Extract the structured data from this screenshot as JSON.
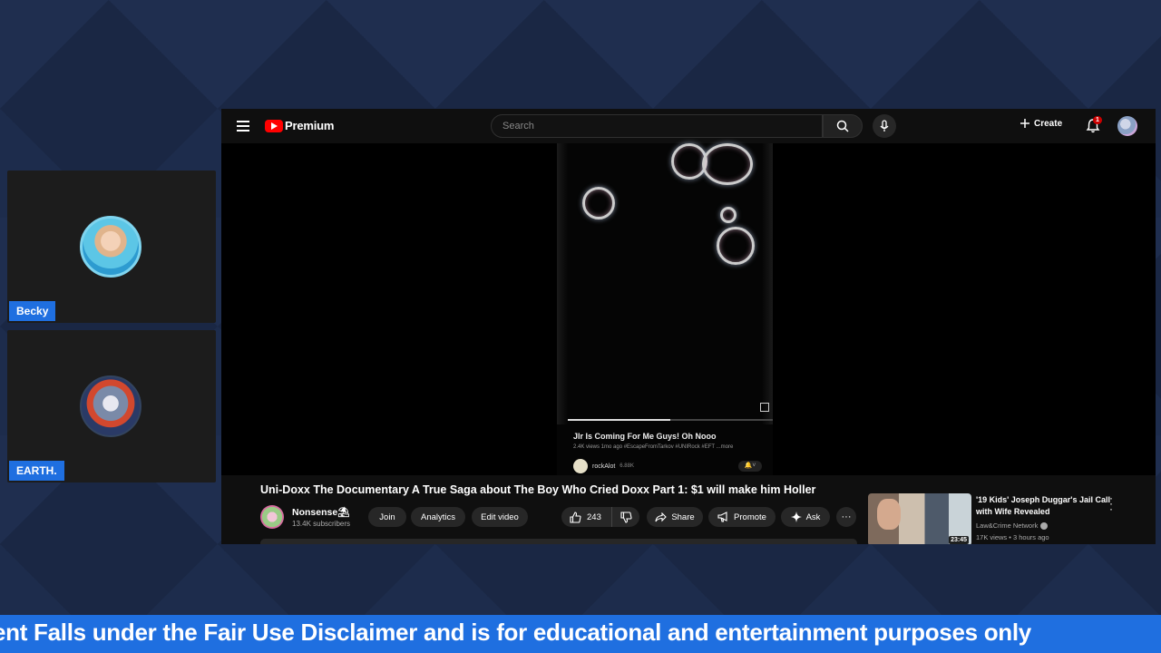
{
  "participants": [
    {
      "name": "Becky"
    },
    {
      "name": "EARTH."
    }
  ],
  "youtube": {
    "logo_text": "Premium",
    "search_placeholder": "Search",
    "create_label": "Create",
    "notification_count": "1",
    "short": {
      "title": "Jlr Is Coming For Me Guys! Oh Nooo",
      "meta": "2.4K views  1mo ago  #EscapeFromTarkov  #UNIRock  #EFT  ...more",
      "channel": "rockAlot",
      "channel_subs": "6.88K",
      "progress": 0.5
    },
    "video_title": "Uni-Doxx The Documentary A True Saga about The Boy Who Cried Doxx Part 1: $1 will make him Holler",
    "channel_name": "Nonsense⛱",
    "channel_subs": "13.4K subscribers",
    "buttons": {
      "join": "Join",
      "analytics": "Analytics",
      "edit_video": "Edit video",
      "like_count": "243",
      "share": "Share",
      "promote": "Promote",
      "ask": "Ask",
      "more": "···"
    },
    "recommended": {
      "title": "'19 Kids' Joseph Duggar's Jail Call with Wife Revealed",
      "channel": "Law&Crime Network",
      "meta": "17K views • 3 hours ago",
      "duration": "23:45"
    }
  },
  "ticker_text": "ent Falls under the Fair Use Disclaimer and is for educational and entertainment purposes only",
  "colors": {
    "accent_blue": "#1f6fe0",
    "youtube_red": "#ff0000",
    "page_bg": "#1a2744"
  }
}
